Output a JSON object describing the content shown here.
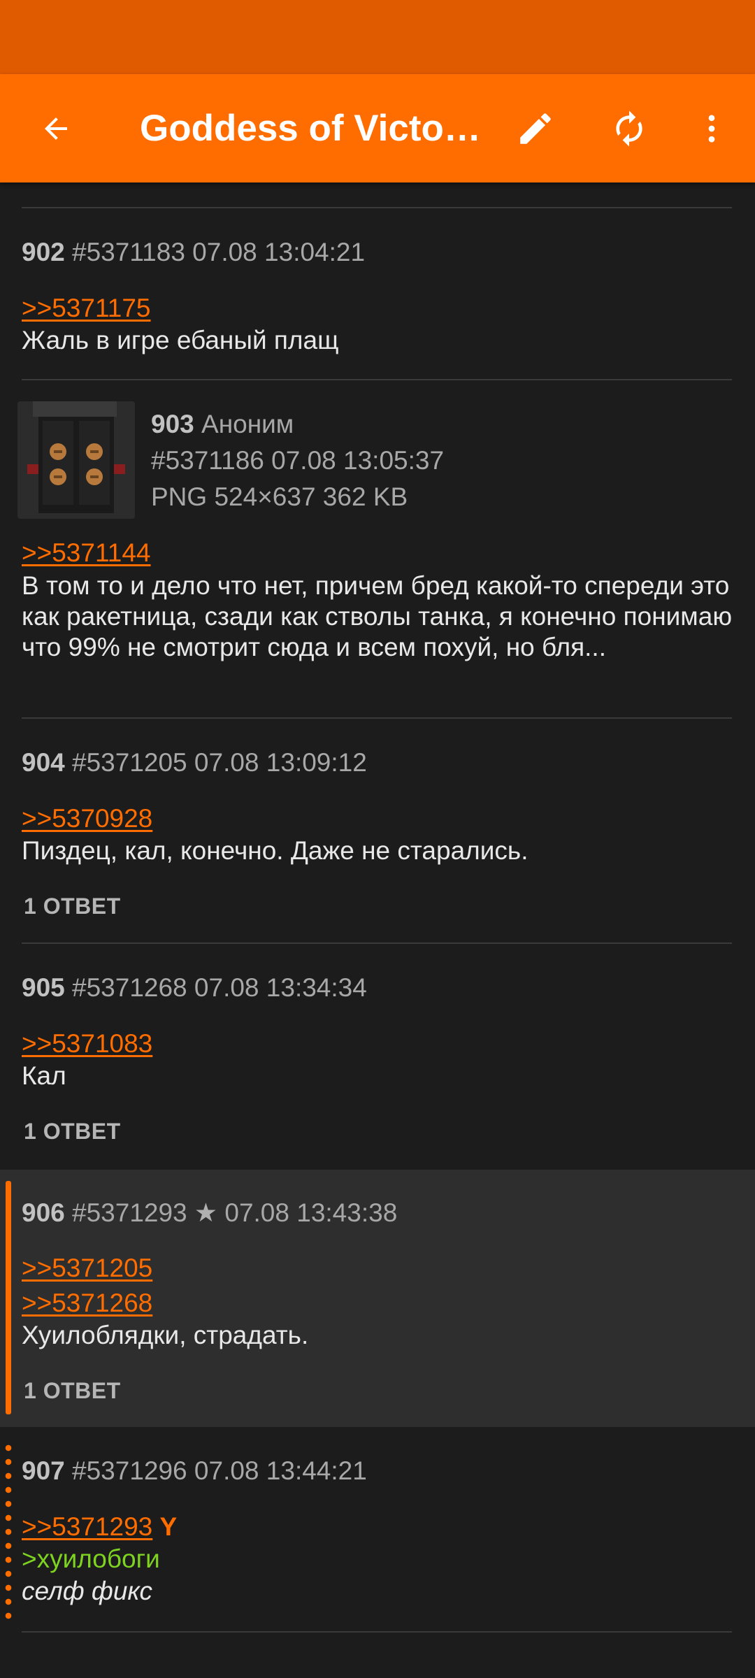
{
  "app_bar": {
    "title": "Goddess of Victory: NIKKE",
    "back_icon": "arrow-back-icon",
    "actions": [
      {
        "name": "edit",
        "icon": "pencil-icon"
      },
      {
        "name": "refresh",
        "icon": "refresh-icon"
      },
      {
        "name": "more",
        "icon": "more-vert-icon"
      }
    ]
  },
  "colors": {
    "accent": "#ff6d00",
    "status_bar": "#e05a00",
    "background": "#1c1c1c",
    "highlight_bg": "#2e2e2e",
    "greentext": "#7ed321"
  },
  "posts": [
    {
      "number": "902",
      "id_time": "#5371183 07.08 13:04:21",
      "links": [
        ">>5371175"
      ],
      "text": "Жаль в игре ебаный плащ"
    },
    {
      "number": "903",
      "author": "Аноним",
      "id_time": "#5371186 07.08 13:05:37",
      "file_info": "PNG 524×637 362 KB",
      "links": [
        ">>5371144"
      ],
      "text": "В том то и дело что нет, причем бред какой-то спереди это как ракетница, сзади как стволы танка, я конечно понимаю что 99% не смотрит сюда и всем похуй, но бля..."
    },
    {
      "number": "904",
      "id_time": "#5371205 07.08 13:09:12",
      "links": [
        ">>5370928"
      ],
      "text": "Пиздец, кал, конечно. Даже не старались.",
      "replies": "1 ОТВЕТ"
    },
    {
      "number": "905",
      "id_time": "#5371268 07.08 13:34:34",
      "links": [
        ">>5371083"
      ],
      "text": "Кал",
      "replies": "1 ОТВЕТ"
    },
    {
      "number": "906",
      "id": "#5371293",
      "star": "★",
      "time": "07.08 13:43:38",
      "links": [
        ">>5371205",
        ">>5371268"
      ],
      "text": "Хуилоблядки, страдать.",
      "replies": "1 ОТВЕТ"
    },
    {
      "number": "907",
      "id_time": "#5371296 07.08 13:44:21",
      "link": ">>5371293",
      "you_mark": "Y",
      "greentext": ">хуилобоги",
      "italic_text": "селф фикс"
    }
  ]
}
